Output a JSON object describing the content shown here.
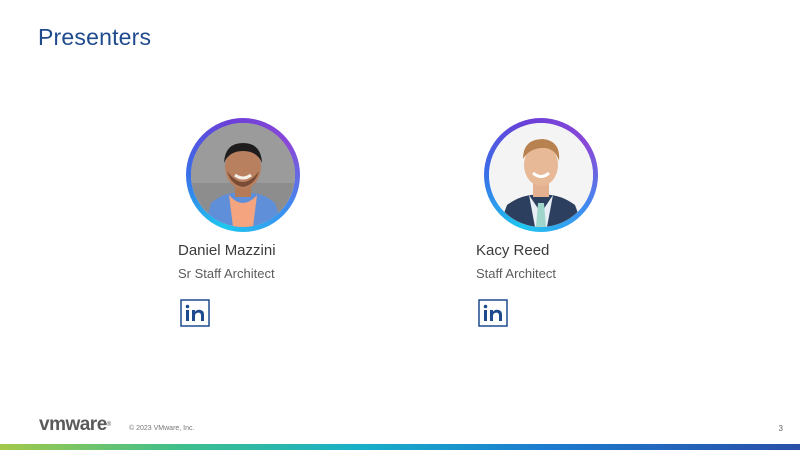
{
  "slide": {
    "title": "Presenters",
    "page_number": "3"
  },
  "presenters": [
    {
      "name": "Daniel Mazzini",
      "role": "Sr Staff Architect",
      "photo_icon": "person-photo",
      "social_icon": "linkedin-icon"
    },
    {
      "name": "Kacy Reed",
      "role": "Staff Architect",
      "photo_icon": "person-photo",
      "social_icon": "linkedin-icon"
    }
  ],
  "footer": {
    "logo_text": "vmware",
    "logo_mark": "®",
    "copyright": "© 2023 VMware, Inc."
  },
  "colors": {
    "title": "#1f4a8e",
    "linkedin": "#1f4a8e",
    "ring_start": "#1ec8f0",
    "ring_end": "#8a48d8"
  }
}
